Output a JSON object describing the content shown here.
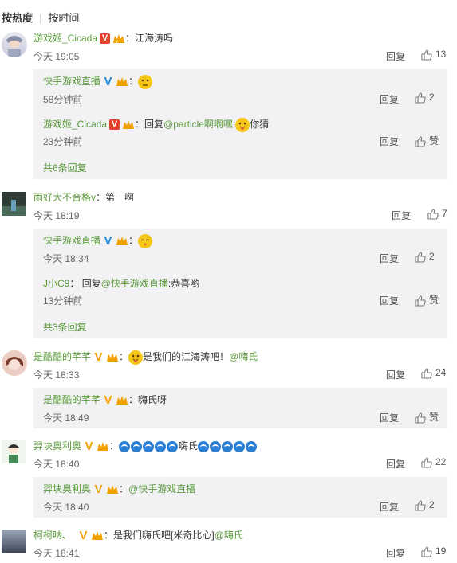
{
  "sort": {
    "hot": "按热度",
    "time": "按时间"
  },
  "comments": [
    {
      "user": "游戏姬_Cicada",
      "text": "江海涛吗",
      "time": "今天 19:05",
      "reply": "回复",
      "likes": "13",
      "subs": [
        {
          "user": "快手游戏直播",
          "text": "",
          "time": "58分钟前",
          "reply": "回复",
          "likes": "2"
        },
        {
          "user": "游戏姬_Cicada",
          "prefix": "回复",
          "mention": "@particle啊啊嘿",
          "suffix": "你猜",
          "time": "23分钟前",
          "reply": "回复",
          "likes": "赞"
        }
      ],
      "more": "共6条回复"
    },
    {
      "user": "雨好大不合格v",
      "text": "第一啊",
      "time": "今天 18:19",
      "reply": "回复",
      "likes": "7",
      "subs": [
        {
          "user": "快手游戏直播",
          "text": "",
          "time": "今天 18:34",
          "reply": "回复",
          "likes": "2"
        },
        {
          "user": "J小C9",
          "prefix": "回复",
          "mention": "@快手游戏直播",
          "suffix": "恭喜哟",
          "time": "13分钟前",
          "reply": "回复",
          "likes": "赞"
        }
      ],
      "more": "共3条回复"
    },
    {
      "user": "是酷酷的芊芊",
      "text": "是我们的江海涛吧！",
      "mention": "@嗨氏",
      "time": "今天 18:33",
      "reply": "回复",
      "likes": "24",
      "subs": [
        {
          "user": "是酷酷的芊芊",
          "text": "嗨氏呀",
          "time": "今天 18:49",
          "reply": "回复",
          "likes": "赞"
        }
      ]
    },
    {
      "user": "羿块奥利奥",
      "text": "嗨氏",
      "time": "今天 18:40",
      "reply": "回复",
      "likes": "22",
      "subs": [
        {
          "user": "羿块奥利奥",
          "mention": "@快手游戏直播",
          "time": "今天 18:40",
          "reply": "回复",
          "likes": "2"
        }
      ]
    },
    {
      "user": "柯柯呐、",
      "text": "是我们嗨氏吧[米奇比心]",
      "mention": "@嗨氏",
      "time": "今天 18:41",
      "reply": "回复",
      "likes": "19"
    }
  ],
  "colors": {
    "username": "#5b9a3a",
    "subbox": "#f2f2f5",
    "vip_red": "#e2422c",
    "vip_blue": "#2a8bd9",
    "vip_gold": "#f2a200"
  }
}
